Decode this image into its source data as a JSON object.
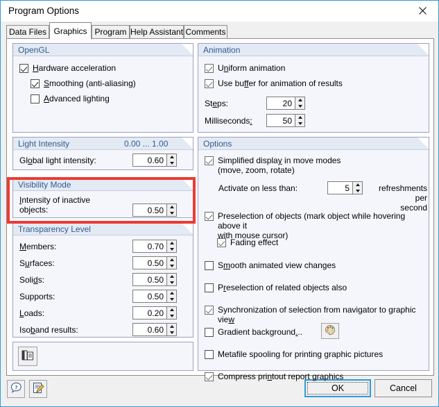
{
  "window": {
    "title": "Program Options",
    "close_icon": "close-icon"
  },
  "tabs": [
    {
      "label": "Data Files",
      "active": false
    },
    {
      "label": "Graphics",
      "active": true
    },
    {
      "label": "Program",
      "active": false
    },
    {
      "label": "Help Assistant",
      "active": false
    },
    {
      "label": "Comments",
      "active": false
    }
  ],
  "groups": {
    "opengl": {
      "title": "OpenGL",
      "items": [
        {
          "label": "Hardware acceleration",
          "checked": true
        },
        {
          "label": "Smoothing (anti-aliasing)",
          "checked": true
        },
        {
          "label": "Advanced lighting",
          "checked": false
        }
      ]
    },
    "animation": {
      "title": "Animation",
      "items": [
        {
          "label": "Uniform animation",
          "checked": true
        },
        {
          "label": "Use buffer for animation of results",
          "checked": true
        }
      ],
      "fields": [
        {
          "label": "Steps:",
          "value": "20"
        },
        {
          "label": "Milliseconds:",
          "value": "50"
        }
      ]
    },
    "light_intensity": {
      "title": "Light Intensity",
      "range": "0.00 ... 1.00",
      "field": {
        "label": "Global light intensity:",
        "value": "0.60"
      }
    },
    "visibility_mode": {
      "title": "Visibility Mode",
      "field": {
        "label": "Intensity of inactive\nobjects:",
        "value": "0.50"
      },
      "highlight_color": "#ec3b33"
    },
    "transparency_level": {
      "title": "Transparency Level",
      "rows": [
        {
          "label": "Members:",
          "value": "0.70"
        },
        {
          "label": "Surfaces:",
          "value": "0.50"
        },
        {
          "label": "Solids:",
          "value": "0.50"
        },
        {
          "label": "Supports:",
          "value": "0.50"
        },
        {
          "label": "Loads:",
          "value": "0.20"
        },
        {
          "label": "Isoband results:",
          "value": "0.60"
        }
      ]
    },
    "options": {
      "title": "Options",
      "simplified": {
        "label": "Simplified display in move modes\n(move, zoom, rotate)",
        "checked": true
      },
      "activate": {
        "label": "Activate on less than:",
        "value": "5",
        "suffix": "refreshments per\nsecond"
      },
      "preselection": {
        "label": "Preselection of objects (mark object while hovering above it\nwith mouse cursor)",
        "checked": true
      },
      "fading": {
        "label": "Fading effect",
        "checked": true
      },
      "smooth": {
        "label": "Smooth animated view changes",
        "checked": false
      },
      "related": {
        "label": "Preselection of related objects also",
        "checked": false
      },
      "sync": {
        "label": "Synchronization of selection from navigator to graphic view",
        "checked": true
      },
      "gradient": {
        "label": "Gradient background...",
        "checked": false,
        "button_icon": "color-palette-icon"
      },
      "metafile": {
        "label": "Metafile spooling for printing graphic pictures",
        "checked": false
      },
      "compress": {
        "label": "Compress printout report graphics",
        "checked": true
      }
    }
  },
  "toolbar": {
    "layout_icon": "layout-panel-icon"
  },
  "footer": {
    "help_icon": "help-icon",
    "notes_icon": "edit-notes-icon",
    "ok_label": "OK",
    "cancel_label": "Cancel"
  }
}
